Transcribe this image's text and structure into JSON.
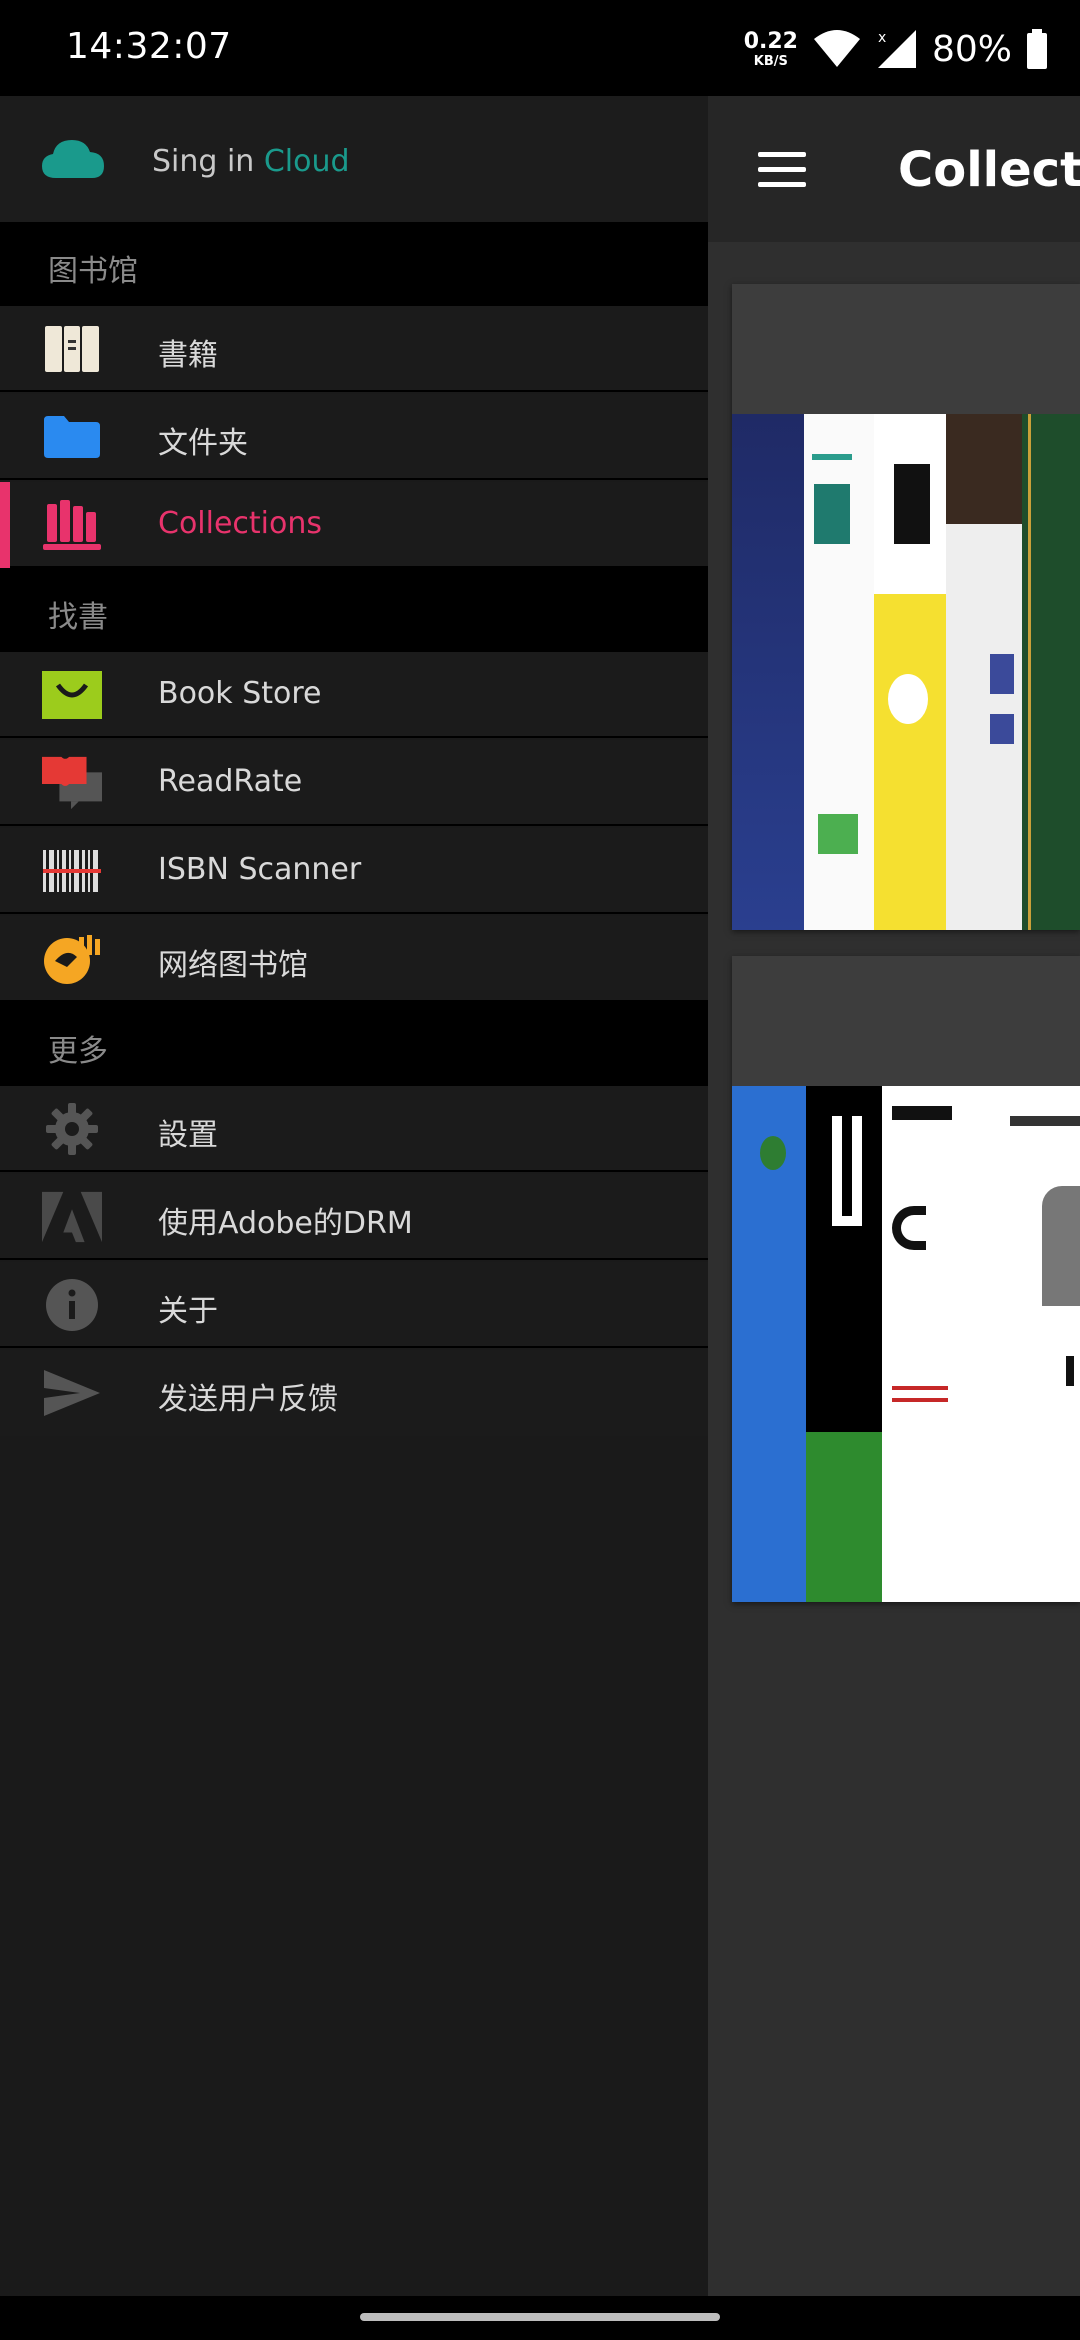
{
  "status_bar": {
    "time": "14:32:07",
    "speed_value": "0.22",
    "speed_unit": "KB/S",
    "battery": "80%"
  },
  "toolbar": {
    "title": "Collections"
  },
  "drawer": {
    "signin_prefix": "Sing in ",
    "signin_accent": "Cloud",
    "sections": [
      {
        "title": "图书馆"
      },
      {
        "title": "找書"
      },
      {
        "title": "更多"
      }
    ],
    "items": [
      {
        "label": "書籍",
        "icon": "books-icon"
      },
      {
        "label": "文件夹",
        "icon": "folder-icon"
      },
      {
        "label": "Collections",
        "icon": "collections-icon",
        "active": true
      },
      {
        "label": "Book Store",
        "icon": "store-bag-icon"
      },
      {
        "label": "ReadRate",
        "icon": "readrate-icon"
      },
      {
        "label": "ISBN Scanner",
        "icon": "barcode-icon"
      },
      {
        "label": "网络图书馆",
        "icon": "network-library-icon"
      },
      {
        "label": "設置",
        "icon": "gear-icon"
      },
      {
        "label": "使用Adobe的DRM",
        "icon": "adobe-icon"
      },
      {
        "label": "关于",
        "icon": "info-icon"
      },
      {
        "label": "发送用户反馈",
        "icon": "send-icon"
      }
    ]
  },
  "colors": {
    "accent": "#e8336c",
    "cloud": "#1a9a8c",
    "folder": "#2a8af0",
    "store": "#9ccc1c",
    "readrate": "#e53935",
    "netlib": "#f5a623"
  }
}
